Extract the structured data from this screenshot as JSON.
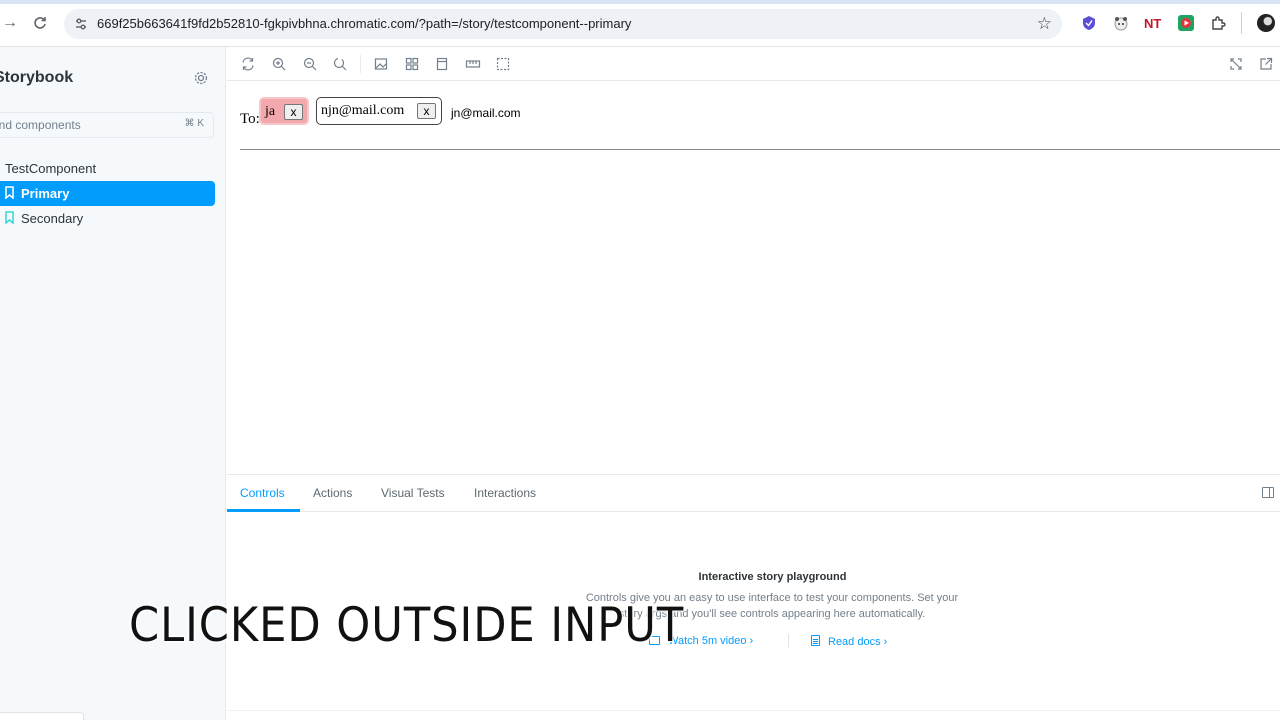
{
  "browser": {
    "url": "669f25b663641f9fd2b52810-fgkpivbhna.chromatic.com/?path=/story/testcomponent--primary",
    "extension_label": "NT"
  },
  "sidebar": {
    "brand": "Storybook",
    "search_placeholder": "ind components",
    "search_shortcut": "⌘ K",
    "group": "TestComponent",
    "stories": [
      {
        "label": "Primary",
        "active": true
      },
      {
        "label": "Secondary",
        "active": false
      }
    ]
  },
  "canvas": {
    "to_label": "To:",
    "chips": [
      {
        "text": "ja",
        "remove_label": "x",
        "invalid": true
      },
      {
        "text": "njn@mail.com",
        "remove_label": "x",
        "invalid": false
      }
    ],
    "input_value": "jn@mail.com"
  },
  "panel": {
    "tabs": [
      "Controls",
      "Actions",
      "Visual Tests",
      "Interactions"
    ],
    "active_tab": "Controls",
    "empty_title": "Interactive story playground",
    "empty_desc": "Controls give you an easy to use interface to test your components. Set your story args and you'll see controls appearing here automatically.",
    "watch_link": "Watch 5m video",
    "docs_link": "Read docs"
  },
  "overlay": {
    "caption": "CLICKED OUTSIDE INPUT"
  },
  "colors": {
    "accent": "#029cfd",
    "invalid_chip": "#f3a8ad",
    "sidebar_bg": "#f6f9fc"
  }
}
